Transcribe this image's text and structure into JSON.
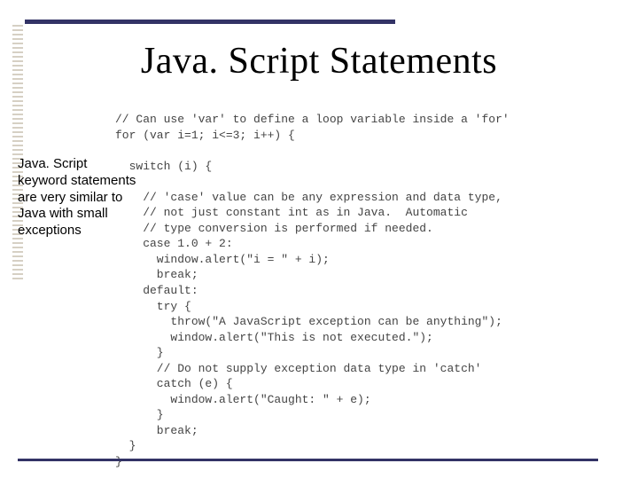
{
  "title": "Java. Script Statements",
  "side_note": "Java. Script keyword statements are very similar to Java with small exceptions",
  "code": "// Can use 'var' to define a loop variable inside a 'for'\nfor (var i=1; i<=3; i++) {\n\n  switch (i) {\n\n    // 'case' value can be any expression and data type,\n    // not just constant int as in Java.  Automatic\n    // type conversion is performed if needed.\n    case 1.0 + 2:\n      window.alert(\"i = \" + i);\n      break;\n    default:\n      try {\n        throw(\"A JavaScript exception can be anything\");\n        window.alert(\"This is not executed.\");\n      }\n      // Do not supply exception data type in 'catch'\n      catch (e) {\n        window.alert(\"Caught: \" + e);\n      }\n      break;\n  }\n}"
}
